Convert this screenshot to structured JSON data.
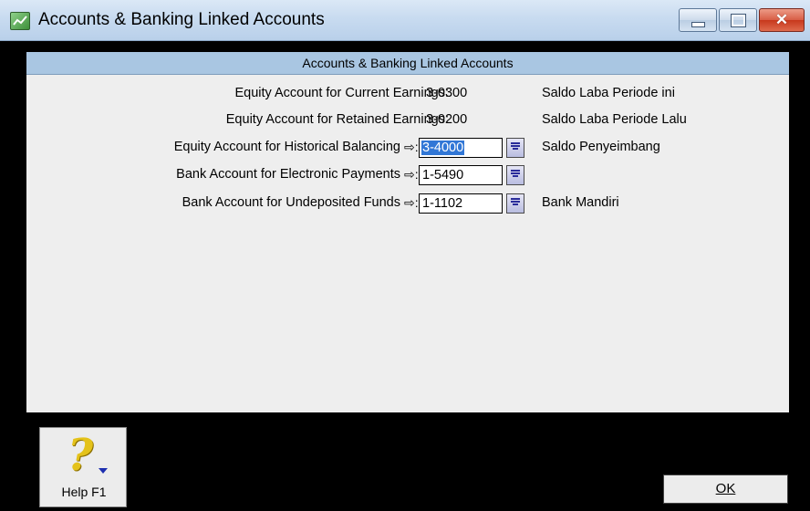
{
  "window": {
    "title": "Accounts & Banking Linked Accounts",
    "close_glyph": "✕"
  },
  "panel": {
    "header": "Accounts & Banking Linked Accounts",
    "arrow_glyph": "⇨:",
    "rows": [
      {
        "label": "Equity Account for Current Earnings:",
        "account": "3-0300",
        "description": "Saldo Laba Periode ini",
        "editable": false
      },
      {
        "label": "Equity Account for Retained Earnings:",
        "account": "3-0200",
        "description": "Saldo Laba Periode Lalu",
        "editable": false
      },
      {
        "label": "Equity Account for Historical Balancing",
        "account": "3-4000",
        "description": "Saldo Penyeimbang",
        "editable": true,
        "selected": true
      },
      {
        "label": "Bank Account for Electronic Payments",
        "account": "1-5490",
        "description": "",
        "editable": true
      },
      {
        "label": "Bank Account for Undeposited Funds",
        "account": "1-1102",
        "description": "Bank Mandiri",
        "editable": true
      }
    ]
  },
  "buttons": {
    "help_label": "Help F1",
    "help_glyph": "?",
    "ok_label": "OK"
  },
  "colors": {
    "titlebar": "#c8dbf0",
    "panel_header": "#a9c6e2",
    "panel_bg": "#eeeeee",
    "selection": "#3177d6",
    "window_bg": "#000000"
  }
}
